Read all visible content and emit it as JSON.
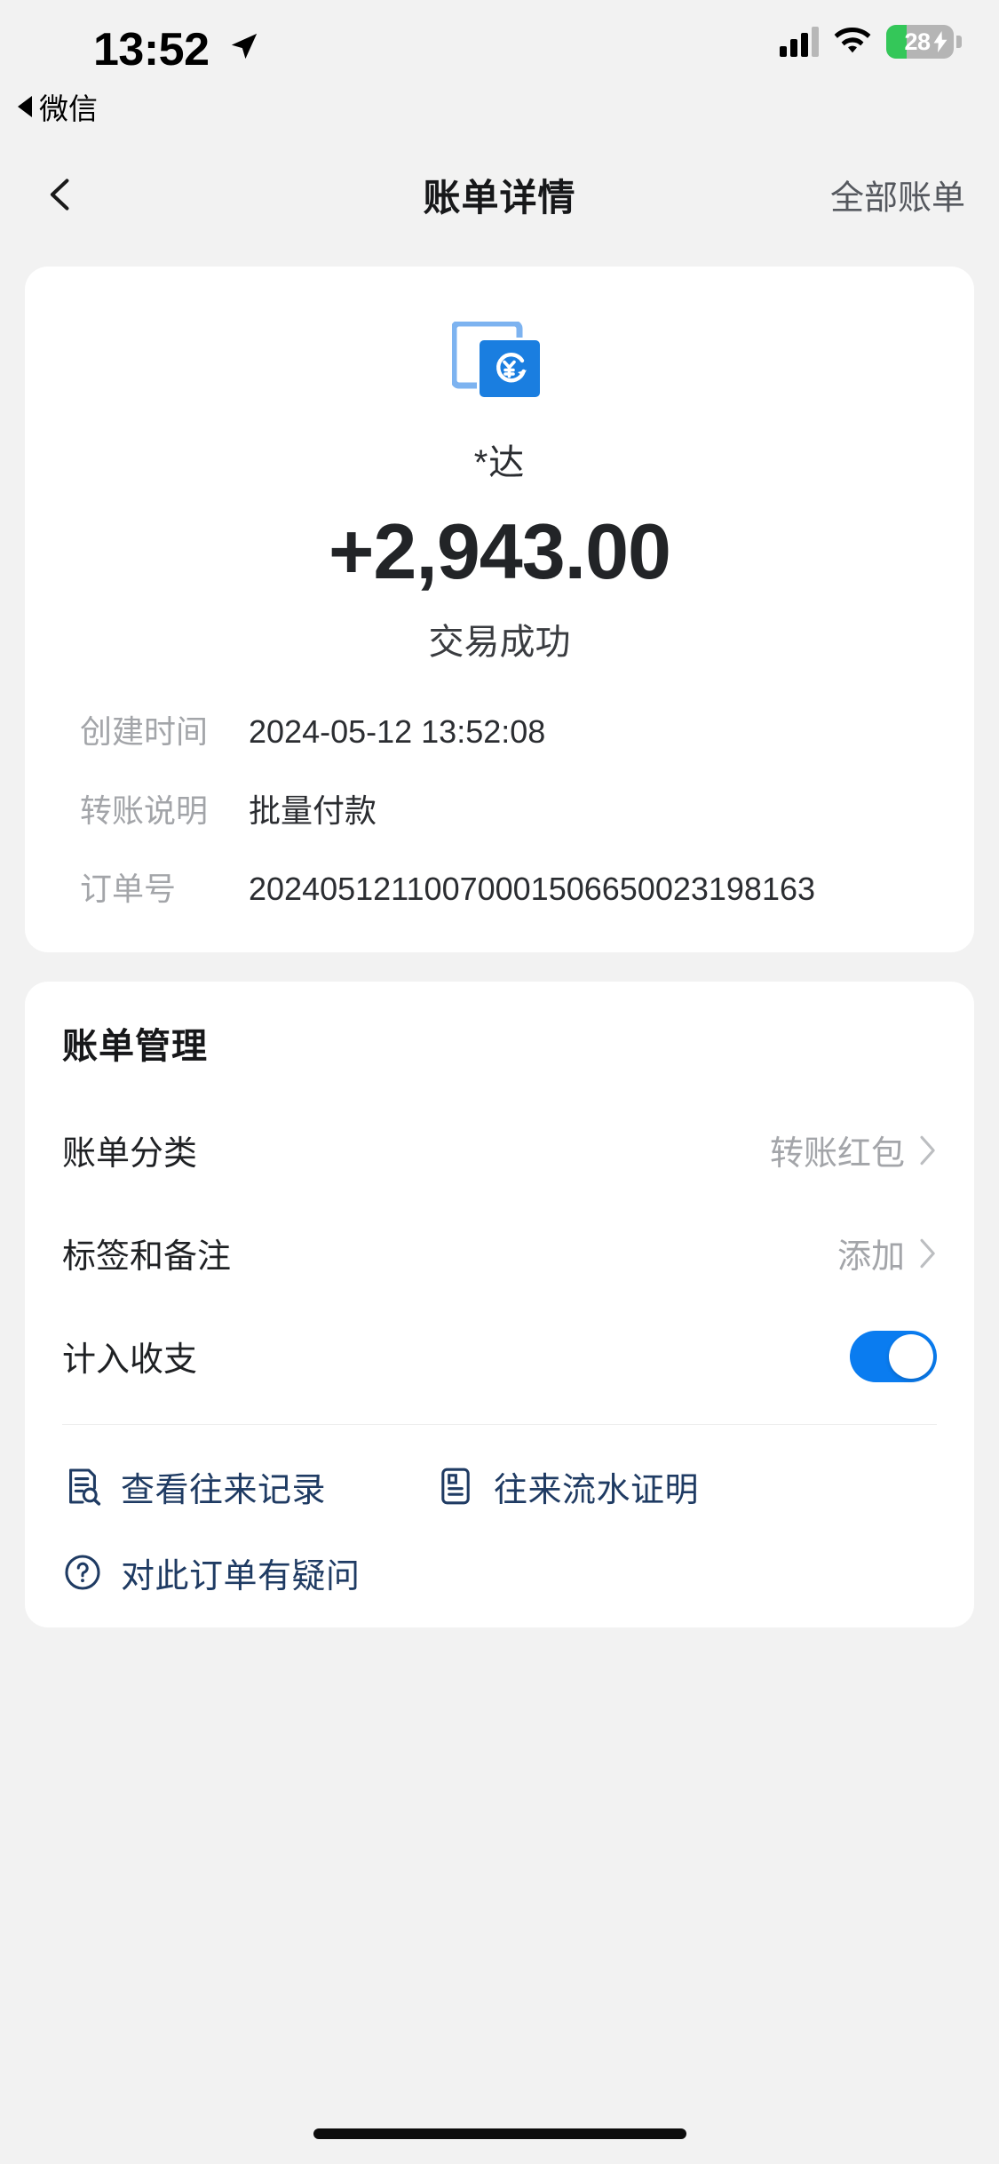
{
  "statusbar": {
    "time": "13:52",
    "location_icon": "location-arrow-icon",
    "back_app_label": "微信",
    "signal_icon": "cellular-signal-icon",
    "wifi_icon": "wifi-icon",
    "battery_level": "28",
    "battery_charging_icon": "bolt-icon",
    "battery_color": "#34c759"
  },
  "navbar": {
    "back_icon": "chevron-left-icon",
    "title": "账单详情",
    "action_label": "全部账单"
  },
  "transaction": {
    "icon": "transfer-red-packet-icon",
    "icon_color": "#1a7ee0",
    "payee_name": "*达",
    "amount": "+2,943.00",
    "status": "交易成功",
    "details": [
      {
        "label": "创建时间",
        "value": "2024-05-12 13:52:08"
      },
      {
        "label": "转账说明",
        "value": "批量付款"
      },
      {
        "label": "订单号",
        "value": "20240512110070001506650023198163"
      }
    ]
  },
  "management": {
    "title": "账单管理",
    "rows": [
      {
        "label": "账单分类",
        "value": "转账红包",
        "chevron": "chevron-right-icon"
      },
      {
        "label": "标签和备注",
        "value": "添加",
        "chevron": "chevron-right-icon"
      }
    ],
    "toggle_row": {
      "label": "计入收支",
      "state": "on",
      "color": "#0a7cf0"
    },
    "links": [
      {
        "label": "查看往来记录",
        "icon": "document-search-icon"
      },
      {
        "label": "往来流水证明",
        "icon": "document-certificate-icon"
      },
      {
        "label": "对此订单有疑问",
        "icon": "question-circle-icon"
      }
    ],
    "link_color": "#1f3b63"
  }
}
